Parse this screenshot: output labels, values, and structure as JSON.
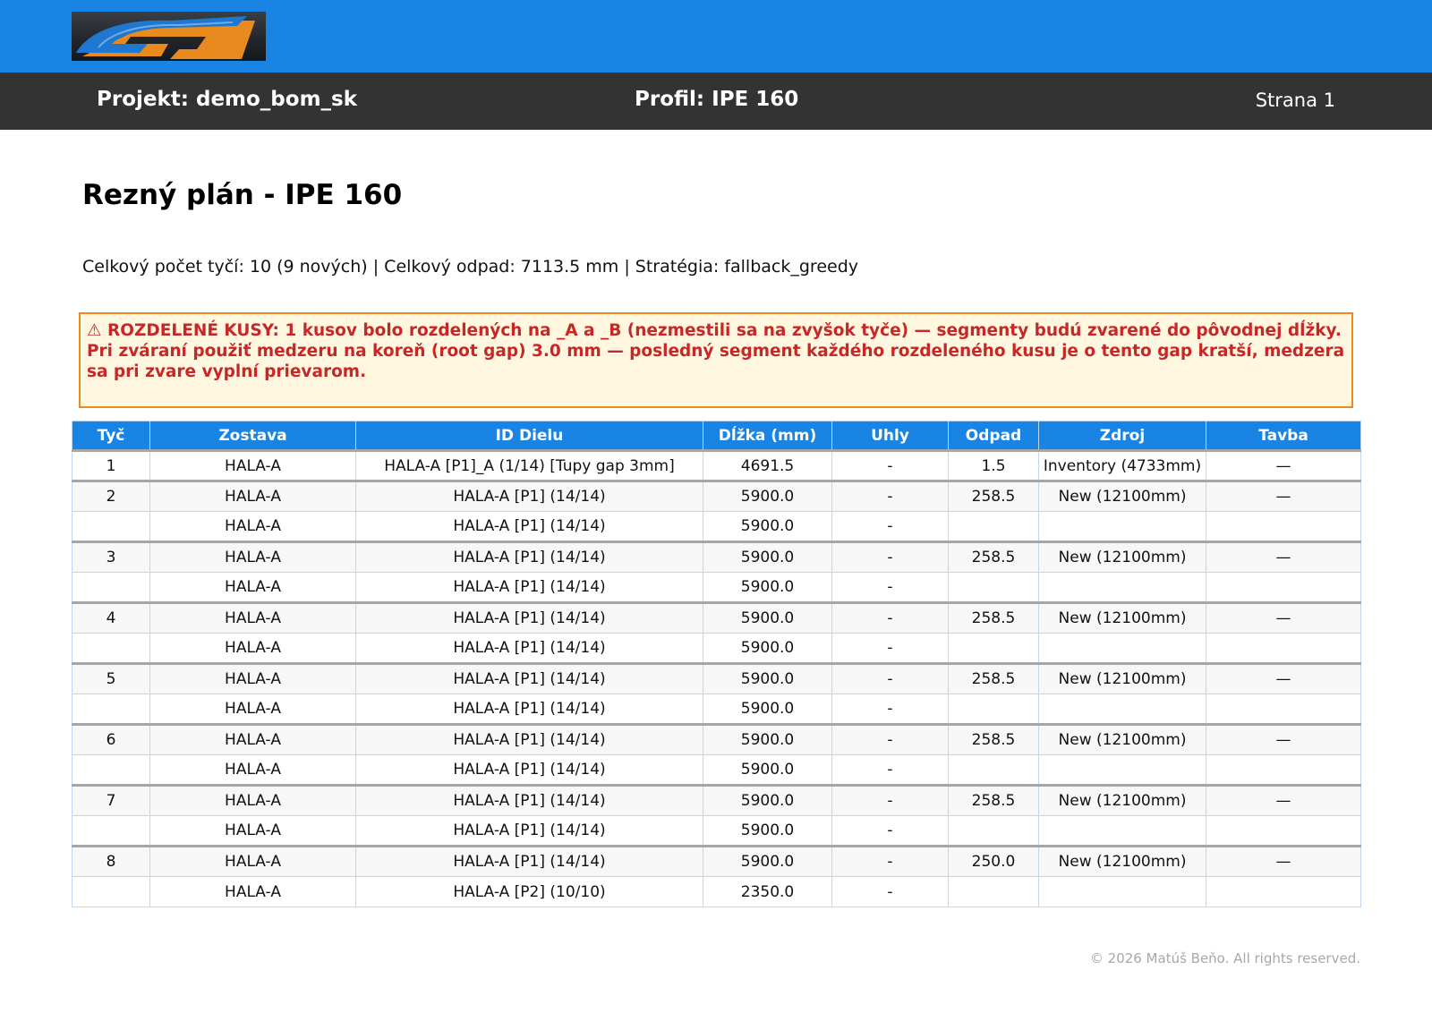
{
  "header": {
    "project": "Projekt: demo_bom_sk",
    "profile": "Profil: IPE 160",
    "page": "Strana 1"
  },
  "colors": {
    "brand_blue": "#1a84e5",
    "dark_bar": "#333333",
    "warning_text": "#c62828",
    "warning_border": "#f08a1c",
    "logo_orange": "#f3901d"
  },
  "title": "Rezný plán - IPE 160",
  "summary": "Celkový počet tyčí: 10 (9 nových) | Celkový odpad: 7113.5 mm | Stratégia: fallback_greedy",
  "warning": {
    "line1": "⚠ ROZDELENÉ KUSY: 1 kusov bolo rozdelených na _A a _B (nezmestili sa na zvyšok tyče) — segmenty budú zvarené do pôvodnej dĺžky.",
    "line2": "Pri zváraní použiť medzeru na koreň (root gap) 3.0 mm — posledný segment každého rozdeleného kusu je o tento gap kratší, medzera sa pri zvare vyplní prievarom."
  },
  "table": {
    "columns": [
      "Tyč",
      "Zostava",
      "ID Dielu",
      "Dĺžka (mm)",
      "Uhly",
      "Odpad",
      "Zdroj",
      "Tavba"
    ],
    "rows": [
      [
        "1",
        "HALA-A",
        "HALA-A [P1]_A (1/14) [Tupy gap 3mm]",
        "4691.5",
        "-",
        "1.5",
        "Inventory (4733mm)",
        "—"
      ],
      [
        "2",
        "HALA-A",
        "HALA-A [P1] (14/14)",
        "5900.0",
        "-",
        "258.5",
        "New (12100mm)",
        "—"
      ],
      [
        "",
        "HALA-A",
        "HALA-A [P1] (14/14)",
        "5900.0",
        "-",
        "",
        "",
        ""
      ],
      [
        "3",
        "HALA-A",
        "HALA-A [P1] (14/14)",
        "5900.0",
        "-",
        "258.5",
        "New (12100mm)",
        "—"
      ],
      [
        "",
        "HALA-A",
        "HALA-A [P1] (14/14)",
        "5900.0",
        "-",
        "",
        "",
        ""
      ],
      [
        "4",
        "HALA-A",
        "HALA-A [P1] (14/14)",
        "5900.0",
        "-",
        "258.5",
        "New (12100mm)",
        "—"
      ],
      [
        "",
        "HALA-A",
        "HALA-A [P1] (14/14)",
        "5900.0",
        "-",
        "",
        "",
        ""
      ],
      [
        "5",
        "HALA-A",
        "HALA-A [P1] (14/14)",
        "5900.0",
        "-",
        "258.5",
        "New (12100mm)",
        "—"
      ],
      [
        "",
        "HALA-A",
        "HALA-A [P1] (14/14)",
        "5900.0",
        "-",
        "",
        "",
        ""
      ],
      [
        "6",
        "HALA-A",
        "HALA-A [P1] (14/14)",
        "5900.0",
        "-",
        "258.5",
        "New (12100mm)",
        "—"
      ],
      [
        "",
        "HALA-A",
        "HALA-A [P1] (14/14)",
        "5900.0",
        "-",
        "",
        "",
        ""
      ],
      [
        "7",
        "HALA-A",
        "HALA-A [P1] (14/14)",
        "5900.0",
        "-",
        "258.5",
        "New (12100mm)",
        "—"
      ],
      [
        "",
        "HALA-A",
        "HALA-A [P1] (14/14)",
        "5900.0",
        "-",
        "",
        "",
        ""
      ],
      [
        "8",
        "HALA-A",
        "HALA-A [P1] (14/14)",
        "5900.0",
        "-",
        "250.0",
        "New (12100mm)",
        "—"
      ],
      [
        "",
        "HALA-A",
        "HALA-A [P2] (10/10)",
        "2350.0",
        "-",
        "",
        "",
        ""
      ]
    ]
  },
  "footer": "© 2026 Matúš Beňo. All rights reserved."
}
